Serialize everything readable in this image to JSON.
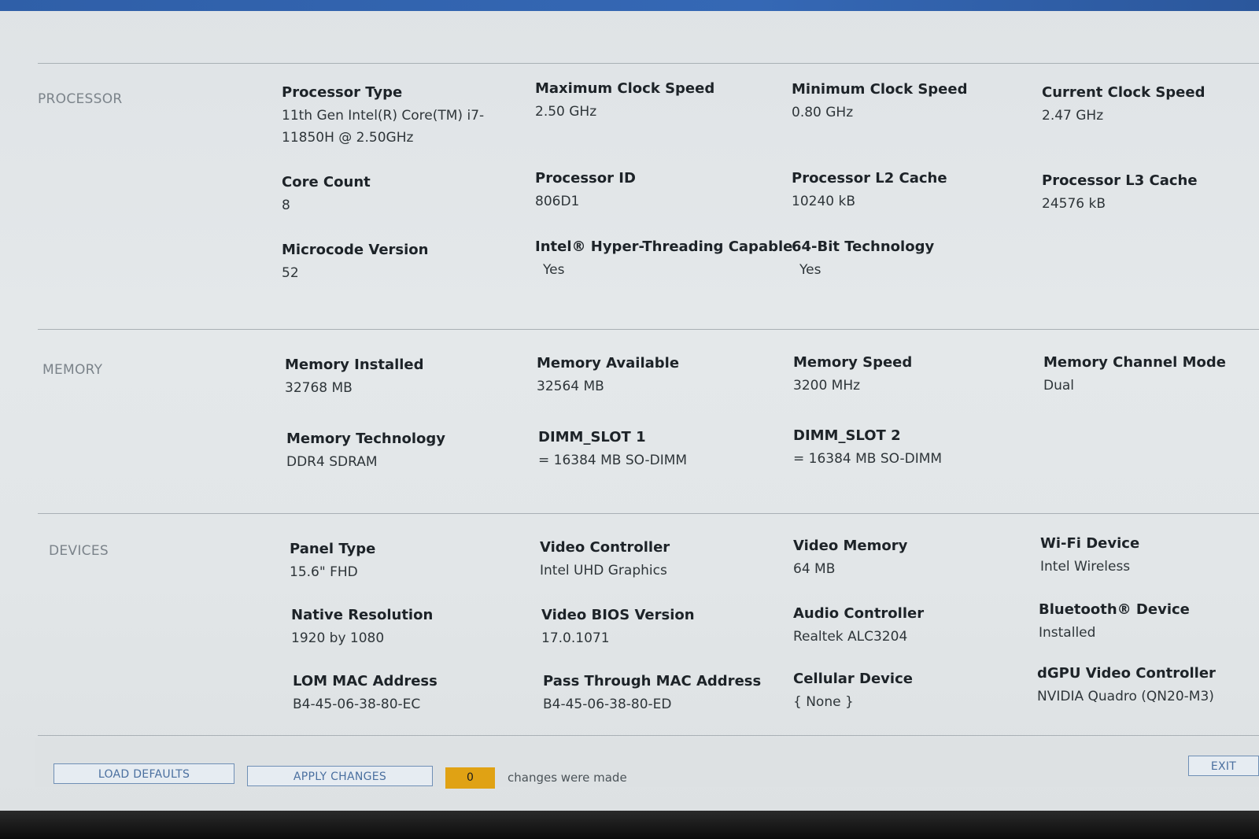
{
  "sections": {
    "processor": "PROCESSOR",
    "memory": "MEMORY",
    "devices": "DEVICES"
  },
  "processor": {
    "type_label": "Processor Type",
    "type_value": "11th Gen Intel(R) Core(TM) i7-11850H @ 2.50GHz",
    "max_clock_label": "Maximum Clock Speed",
    "max_clock_value": "2.50 GHz",
    "min_clock_label": "Minimum Clock Speed",
    "min_clock_value": "0.80 GHz",
    "cur_clock_label": "Current Clock Speed",
    "cur_clock_value": "2.47 GHz",
    "core_count_label": "Core Count",
    "core_count_value": "8",
    "id_label": "Processor ID",
    "id_value": "806D1",
    "l2_label": "Processor L2 Cache",
    "l2_value": "10240 kB",
    "l3_label": "Processor L3 Cache",
    "l3_value": "24576 kB",
    "microcode_label": "Microcode Version",
    "microcode_value": "52",
    "ht_label": "Intel® Hyper-Threading Capable",
    "ht_value": "Yes",
    "x64_label": "64-Bit Technology",
    "x64_value": "Yes"
  },
  "memory": {
    "installed_label": "Memory Installed",
    "installed_value": "32768 MB",
    "available_label": "Memory Available",
    "available_value": "32564 MB",
    "speed_label": "Memory Speed",
    "speed_value": "3200 MHz",
    "channel_label": "Memory Channel Mode",
    "channel_value": "Dual",
    "tech_label": "Memory Technology",
    "tech_value": "DDR4 SDRAM",
    "slot1_label": "DIMM_SLOT 1",
    "slot1_value": "= 16384 MB SO-DIMM",
    "slot2_label": "DIMM_SLOT 2",
    "slot2_value": "= 16384 MB SO-DIMM"
  },
  "devices": {
    "panel_label": "Panel Type",
    "panel_value": "15.6\" FHD",
    "video_ctrl_label": "Video Controller",
    "video_ctrl_value": "Intel UHD Graphics",
    "video_mem_label": "Video Memory",
    "video_mem_value": "64 MB",
    "wifi_label": "Wi-Fi Device",
    "wifi_value": "Intel Wireless",
    "native_res_label": "Native Resolution",
    "native_res_value": "1920 by 1080",
    "vbios_label": "Video BIOS Version",
    "vbios_value": "17.0.1071",
    "audio_label": "Audio Controller",
    "audio_value": "Realtek ALC3204",
    "bt_label": "Bluetooth® Device",
    "bt_value": "Installed",
    "lom_mac_label": "LOM MAC Address",
    "lom_mac_value": "B4-45-06-38-80-EC",
    "pt_mac_label": "Pass Through MAC Address",
    "pt_mac_value": "B4-45-06-38-80-ED",
    "cellular_label": "Cellular Device",
    "cellular_value": "{ None }",
    "dgpu_label": "dGPU Video Controller",
    "dgpu_value": "NVIDIA Quadro (QN20-M3)"
  },
  "footer": {
    "load_defaults": "LOAD DEFAULTS",
    "apply_changes": "APPLY CHANGES",
    "changes_count": "0",
    "changes_text": "changes were made",
    "exit": "EXIT"
  },
  "colors": {
    "accent": "#2f5fa8",
    "changes_badge": "#e0a214"
  }
}
